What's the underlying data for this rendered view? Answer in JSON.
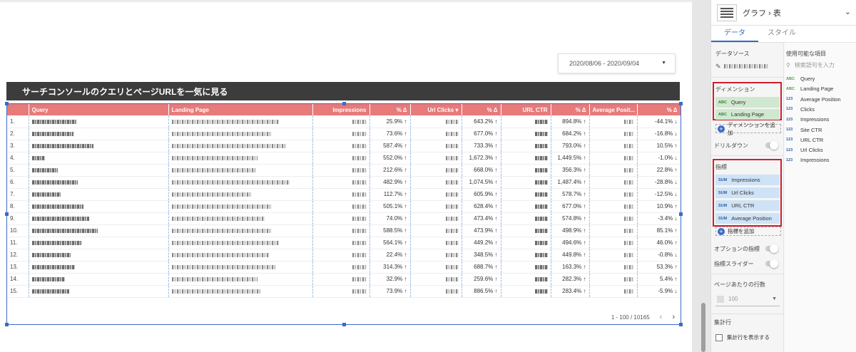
{
  "date_range": "2020/08/06 - 2020/09/04",
  "report_title": "サーチコンソールのクエリとページURLを一気に見る",
  "table": {
    "columns": [
      "Query",
      "Landing Page",
      "Impressions",
      "% Δ",
      "Url Clicks ▾",
      "% Δ",
      "URL CTR",
      "% Δ",
      "Average Posit...",
      "% Δ"
    ],
    "rows": [
      {
        "n": "1.",
        "imp_d": "25.9% ↑",
        "clk_d": "643.2% ↑",
        "ctr_d": "894.8% ↑",
        "pos_d": "-44.1% ↓"
      },
      {
        "n": "2.",
        "imp_d": "73.6% ↑",
        "clk_d": "677.0% ↑",
        "ctr_d": "684.2% ↑",
        "pos_d": "-16.8% ↓"
      },
      {
        "n": "3.",
        "imp_d": "587.4% ↑",
        "clk_d": "733.3% ↑",
        "ctr_d": "793.0% ↑",
        "pos_d": "10.5% ↑"
      },
      {
        "n": "4.",
        "imp_d": "552.0% ↑",
        "clk_d": "1,672.3% ↑",
        "ctr_d": "1,449.5% ↑",
        "pos_d": "-1.0% ↓"
      },
      {
        "n": "5.",
        "imp_d": "212.6% ↑",
        "clk_d": "668.0% ↑",
        "ctr_d": "356.3% ↑",
        "pos_d": "22.8% ↑"
      },
      {
        "n": "6.",
        "imp_d": "482.9% ↑",
        "clk_d": "1,074.5% ↑",
        "ctr_d": "1,487.4% ↑",
        "pos_d": "-28.8% ↓"
      },
      {
        "n": "7.",
        "imp_d": "112.7% ↑",
        "clk_d": "605.9% ↑",
        "ctr_d": "578.7% ↑",
        "pos_d": "-12.5% ↓"
      },
      {
        "n": "8.",
        "imp_d": "505.1% ↑",
        "clk_d": "628.4% ↑",
        "ctr_d": "677.0% ↑",
        "pos_d": "10.9% ↑"
      },
      {
        "n": "9.",
        "imp_d": "74.0% ↑",
        "clk_d": "473.4% ↑",
        "ctr_d": "574.8% ↑",
        "pos_d": "-3.4% ↓"
      },
      {
        "n": "10.",
        "imp_d": "588.5% ↑",
        "clk_d": "473.9% ↑",
        "ctr_d": "498.9% ↑",
        "pos_d": "85.1% ↑"
      },
      {
        "n": "11.",
        "imp_d": "564.1% ↑",
        "clk_d": "449.2% ↑",
        "ctr_d": "494.6% ↑",
        "pos_d": "46.0% ↑"
      },
      {
        "n": "12.",
        "imp_d": "22.4% ↑",
        "clk_d": "348.5% ↑",
        "ctr_d": "449.8% ↑",
        "pos_d": "-0.8% ↓"
      },
      {
        "n": "13.",
        "imp_d": "314.3% ↑",
        "clk_d": "688.7% ↑",
        "ctr_d": "163.3% ↑",
        "pos_d": "53.3% ↑"
      },
      {
        "n": "14.",
        "imp_d": "32.9% ↑",
        "clk_d": "259.6% ↑",
        "ctr_d": "282.3% ↑",
        "pos_d": "5.4% ↑"
      },
      {
        "n": "15.",
        "imp_d": "73.9% ↑",
        "clk_d": "886.5% ↑",
        "ctr_d": "283.4% ↑",
        "pos_d": "-5.9% ↓"
      }
    ],
    "pagination": "1 - 100 / 10165",
    "prev": "‹",
    "next": "›"
  },
  "panel": {
    "title": "グラフ › 表",
    "chevron": "⌄",
    "tabs": [
      "データ",
      "スタイル"
    ],
    "datasource_label": "データソース",
    "dimension_label": "ディメンション",
    "dimensions": [
      "Query",
      "Landing Page"
    ],
    "add_dimension": "ディメンションを追加",
    "drilldown": "ドリルダウン",
    "metric_label": "指標",
    "metrics": [
      "Impressions",
      "Url Clicks",
      "URL CTR",
      "Average Position"
    ],
    "add_metric": "指標を追加",
    "optional_metrics": "オプションの指標",
    "metric_slider": "指標スライダー",
    "rows_per_page_label": "ページあたりの行数",
    "rows_per_page": "100",
    "summary_label": "集計行",
    "show_summary": "集計行を表示する",
    "available_fields_label": "使用可能な項目",
    "search_placeholder": "検索語句を入力",
    "fields": [
      {
        "type": "ABC",
        "name": "Query"
      },
      {
        "type": "ABC",
        "name": "Landing Page"
      },
      {
        "type": "123",
        "name": "Average Position"
      },
      {
        "type": "123",
        "name": "Clicks"
      },
      {
        "type": "123",
        "name": "Impressions"
      },
      {
        "type": "123",
        "name": "Site CTR"
      },
      {
        "type": "123",
        "name": "URL CTR"
      },
      {
        "type": "123",
        "name": "Url Clicks"
      },
      {
        "type": "123",
        "name": "Impressions"
      }
    ],
    "dim_type": "ABC",
    "met_type": "SUM"
  },
  "colors": {
    "header_red": "#e87a7a",
    "accent_blue": "#3a69c7",
    "highlight_red": "#d01e2c"
  }
}
